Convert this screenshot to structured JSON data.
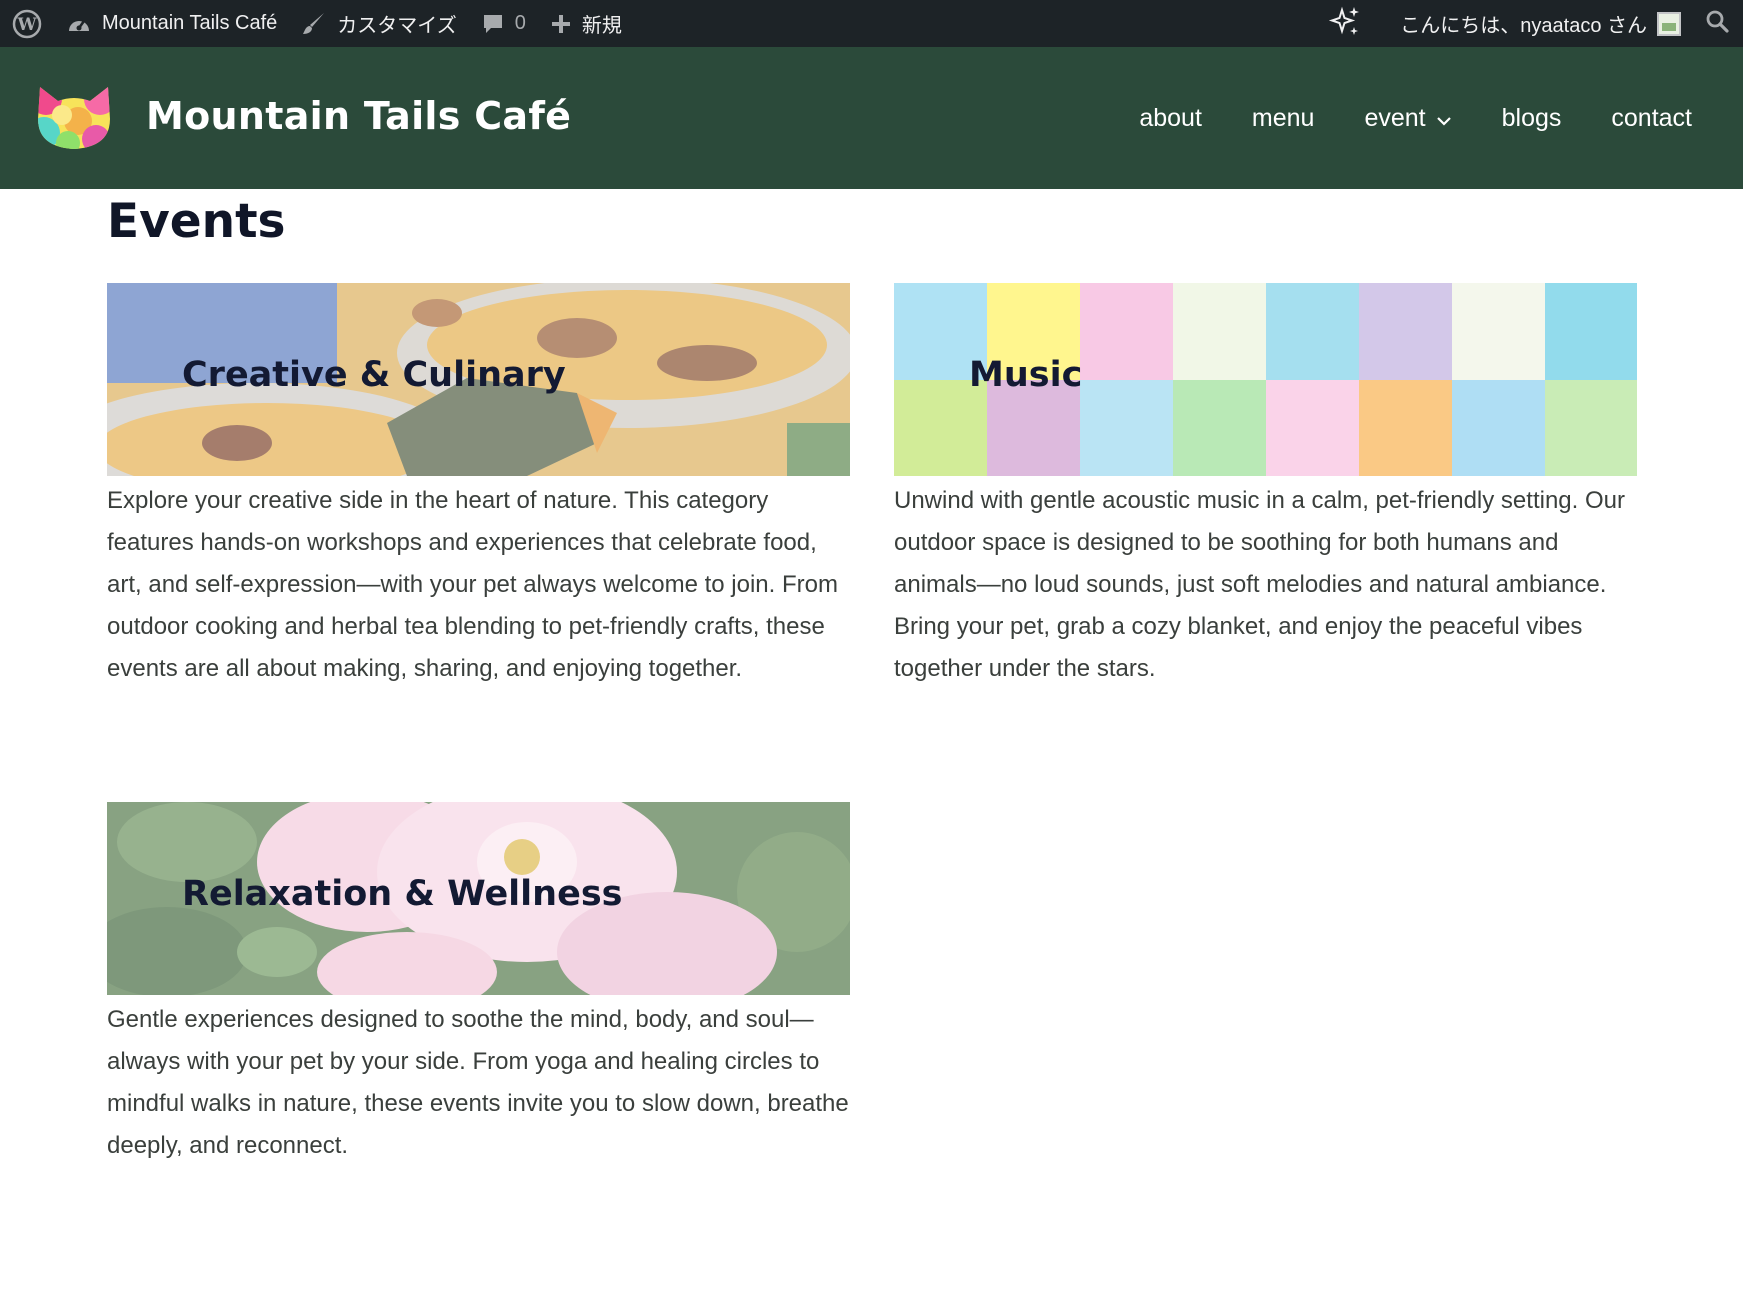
{
  "admin_bar": {
    "site_name": "Mountain Tails Café",
    "customize_label": "カスタマイズ",
    "comments_count": "0",
    "new_label": "新規",
    "greeting": "こんにちは、nyaataco さん",
    "icons": [
      "wordpress-icon",
      "dashboard-icon",
      "brush-icon",
      "comment-icon",
      "plus-icon",
      "sparkle-icon",
      "search-icon"
    ]
  },
  "header": {
    "site_title": "Mountain Tails Café",
    "nav": [
      {
        "label": "about"
      },
      {
        "label": "menu"
      },
      {
        "label": "event"
      },
      {
        "label": "blogs"
      },
      {
        "label": "contact"
      }
    ]
  },
  "main": {
    "page_title": "Events",
    "cards": [
      {
        "title": "Creative & Culinary",
        "description": "Explore your creative side in the heart of nature. This category features hands-on workshops and experiences that celebrate food, art, and self-expression—with your pet always welcome to join. From outdoor cooking and herbal tea blending to pet-friendly crafts, these events are all about making, sharing, and enjoying together."
      },
      {
        "title": "Music",
        "description": "Unwind with gentle acoustic music in a calm, pet-friendly setting. Our outdoor space is designed to be soothing for both humans and animals—no loud sounds, just soft melodies and natural ambiance. Bring your pet, grab a cozy blanket, and enjoy the peaceful vibes together under the stars."
      },
      {
        "title": "Relaxation & Wellness",
        "description": "Gentle experiences designed to soothe the mind, body, and soul—always with your pet by your side. From yoga and healing circles to mindful walks in nature, these events invite you to slow down, breathe deeply, and reconnect."
      }
    ]
  },
  "colors": {
    "admin_bar_bg": "#1d2327",
    "header_bg": "#2b4a3a",
    "title_text": "#101628"
  }
}
